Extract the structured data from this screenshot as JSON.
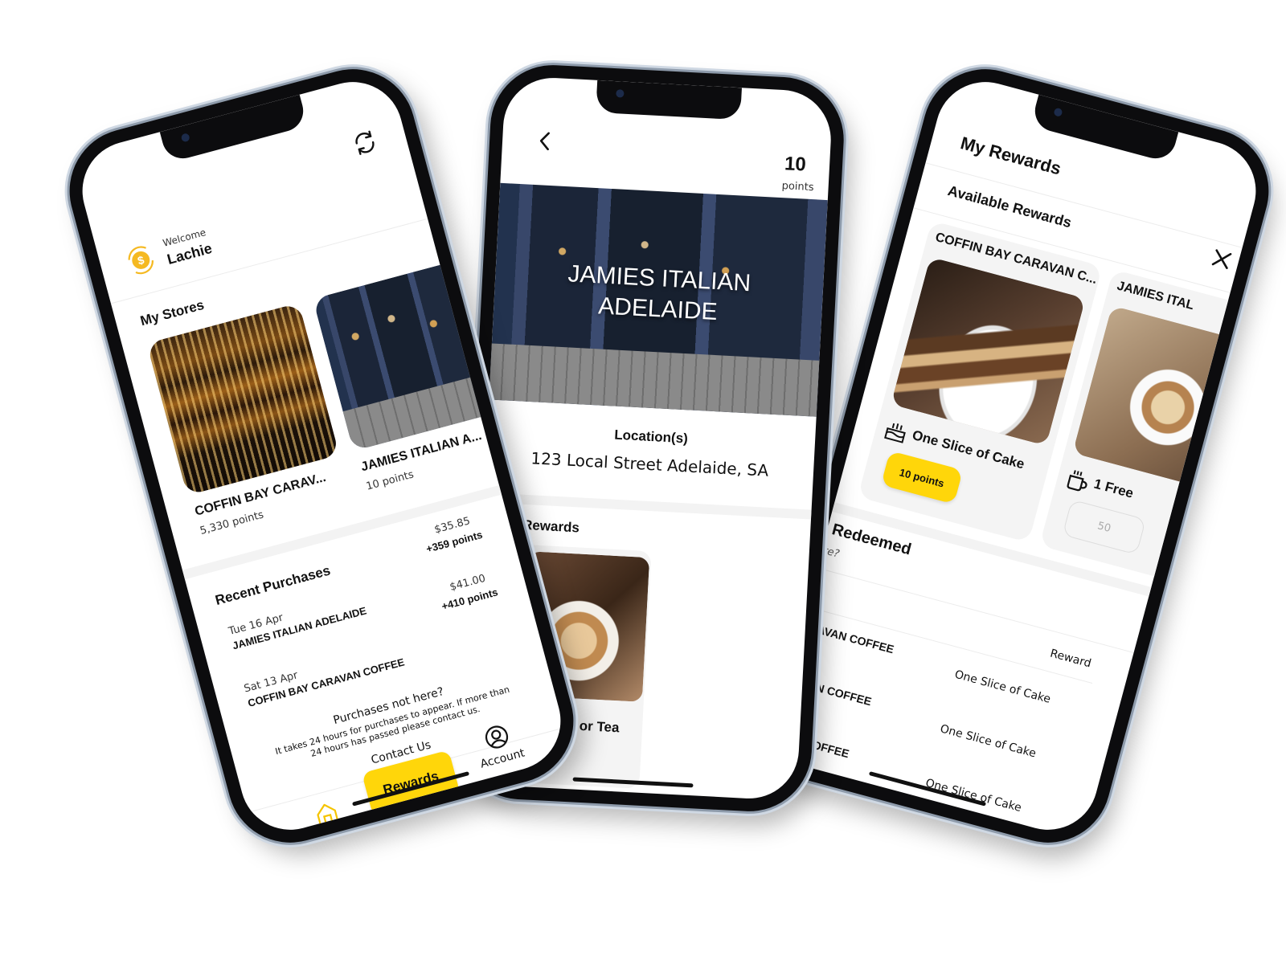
{
  "home": {
    "welcome_label": "Welcome",
    "user_name": "Lachie",
    "my_stores_title": "My Stores",
    "stores": [
      {
        "name": "COFFIN BAY CARAV...",
        "points": "5,330 points"
      },
      {
        "name": "JAMIES ITALIAN A...",
        "points": "10 points"
      }
    ],
    "recent_purchases_title": "Recent Purchases",
    "purchases": [
      {
        "date": "Tue 16 Apr",
        "store": "JAMIES ITALIAN ADELAIDE",
        "amount": "$35.85",
        "points": "+359 points"
      },
      {
        "date": "Sat 13 Apr",
        "store": "COFFIN BAY CARAVAN COFFEE",
        "amount": "$41.00",
        "points": "+410 points"
      }
    ],
    "purchases_missing_title": "Purchases not here?",
    "purchases_missing_line1": "It takes 24 hours for purchases to appear. If more than",
    "purchases_missing_line2": "24 hours has passed please contact us.",
    "contact_us": "Contact Us",
    "nav": {
      "home": "Home",
      "rewards": "Rewards",
      "account": "Account"
    }
  },
  "store": {
    "points_value": "10",
    "points_label": "points",
    "store_name_line1": "JAMIES ITALIAN",
    "store_name_line2": "ADELAIDE",
    "location_label": "Location(s)",
    "address": "123 Local Street Adelaide, SA",
    "rewards_title": "Rewards",
    "reward_partial": "ee or Tea"
  },
  "rewards": {
    "title": "My Rewards",
    "available_title": "Available Rewards",
    "store1_name": "COFFIN BAY CARAVAN C...",
    "store2_name": "JAMIES ITAL",
    "reward1_name": "One Slice of Cake",
    "reward1_points": "10 points",
    "reward2_name": "1 Free",
    "reward2_points": "50",
    "redeemed_title": "Redeemed",
    "redeemed_question": "ere?",
    "reward_column": "Reward",
    "redeemed_rows": [
      {
        "store": "CARAVAN COFFEE",
        "reward": "One Slice of Cake"
      },
      {
        "store": "ARAVAN COFFEE",
        "reward": "One Slice of Cake"
      },
      {
        "store": "RAVAN COFFEE",
        "reward": "One Slice of Cake"
      }
    ],
    "redeemed_partial": "One Slice of Ca"
  },
  "colors": {
    "accent": "#ffd60a",
    "frame": "#0c0c0e",
    "frame_rim": "#cfd8e3",
    "muted_gray": "#f3f3f3"
  },
  "icons": [
    "refresh-icon",
    "coin-exchange-icon",
    "back-chevron-icon",
    "home-icon",
    "account-icon",
    "close-icon",
    "cake-icon",
    "coffee-cup-icon"
  ]
}
